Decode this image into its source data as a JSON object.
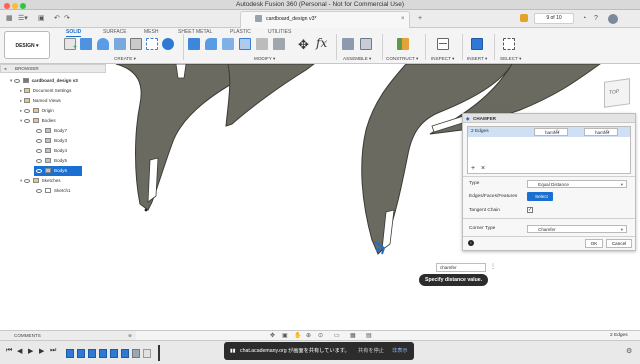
{
  "window": {
    "title": "Autodesk Fusion 360 (Personal - Not for Commercial Use)",
    "controls": {
      "close": "#ff5f57",
      "minimize": "#febc2e",
      "zoom": "#28c840"
    }
  },
  "tabbar": {
    "doc_tab": "cardboard_design v3*",
    "counter": "9 of 10"
  },
  "ribbon": {
    "workspace": "DESIGN",
    "tabs": [
      "SOLID",
      "SURFACE",
      "MESH",
      "SHEET METAL",
      "PLASTIC",
      "UTILITIES"
    ],
    "active_tab": "SOLID",
    "groups": [
      "CREATE",
      "MODIFY",
      "ASSEMBLE",
      "CONSTRUCT",
      "INSPECT",
      "INSERT",
      "SELECT"
    ],
    "fx_label": "fx"
  },
  "browser": {
    "header": "BROWSER",
    "nodes": [
      {
        "label": "cardboard_design v3",
        "indent": 0
      },
      {
        "label": "Document Settings",
        "indent": 1
      },
      {
        "label": "Named Views",
        "indent": 1
      },
      {
        "label": "Origin",
        "indent": 1
      },
      {
        "label": "Bodies",
        "indent": 1
      },
      {
        "label": "Body7",
        "indent": 2
      },
      {
        "label": "Body3",
        "indent": 2
      },
      {
        "label": "Body4",
        "indent": 2
      },
      {
        "label": "Body5",
        "indent": 2
      },
      {
        "label": "Body6",
        "indent": 2,
        "selected": true
      },
      {
        "label": "Sketches",
        "indent": 1
      },
      {
        "label": "Sketch1",
        "indent": 2
      }
    ]
  },
  "viewcube": {
    "label": "TOP"
  },
  "chamfer": {
    "title": "CHAMFER",
    "edges_label": "2 Edges",
    "edge_val1": "hamfer",
    "edge_val2": "hamfer",
    "fx1": "fx",
    "fx2": "fx",
    "add_icon": "+",
    "remove_icon": "×",
    "type_label": "Type",
    "type_value": "Equal Distance",
    "edges_field_label": "Edges/Faces/Features",
    "select_label": "Select",
    "tangent_label": "Tangent Chain",
    "tangent_checked": true,
    "corner_label": "Corner Type",
    "corner_value": "Chamfer",
    "ok": "OK",
    "cancel": "Cancel"
  },
  "canvas": {
    "input_value": "chamfer",
    "tooltip": "Specify distance value."
  },
  "comments": {
    "label": "COMMENTS"
  },
  "status": {
    "selection": "2 Edges"
  },
  "sharing": {
    "text": "chat.academany.org が画面を共有しています。",
    "stop": "共有を停止",
    "hide": "非表示"
  },
  "colors": {
    "accent": "#1b6fd1",
    "body_fill": "#6a6a60",
    "body_edge": "#3b3b35"
  }
}
